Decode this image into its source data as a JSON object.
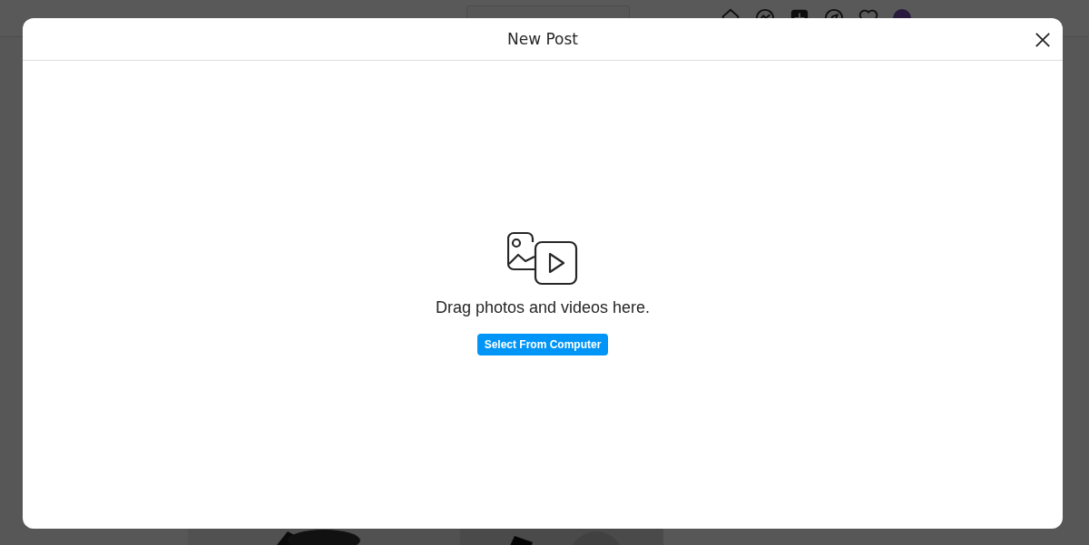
{
  "dialog": {
    "title": "New Post",
    "message": "Drag photos and videos here.",
    "button": "Select From Computer"
  }
}
